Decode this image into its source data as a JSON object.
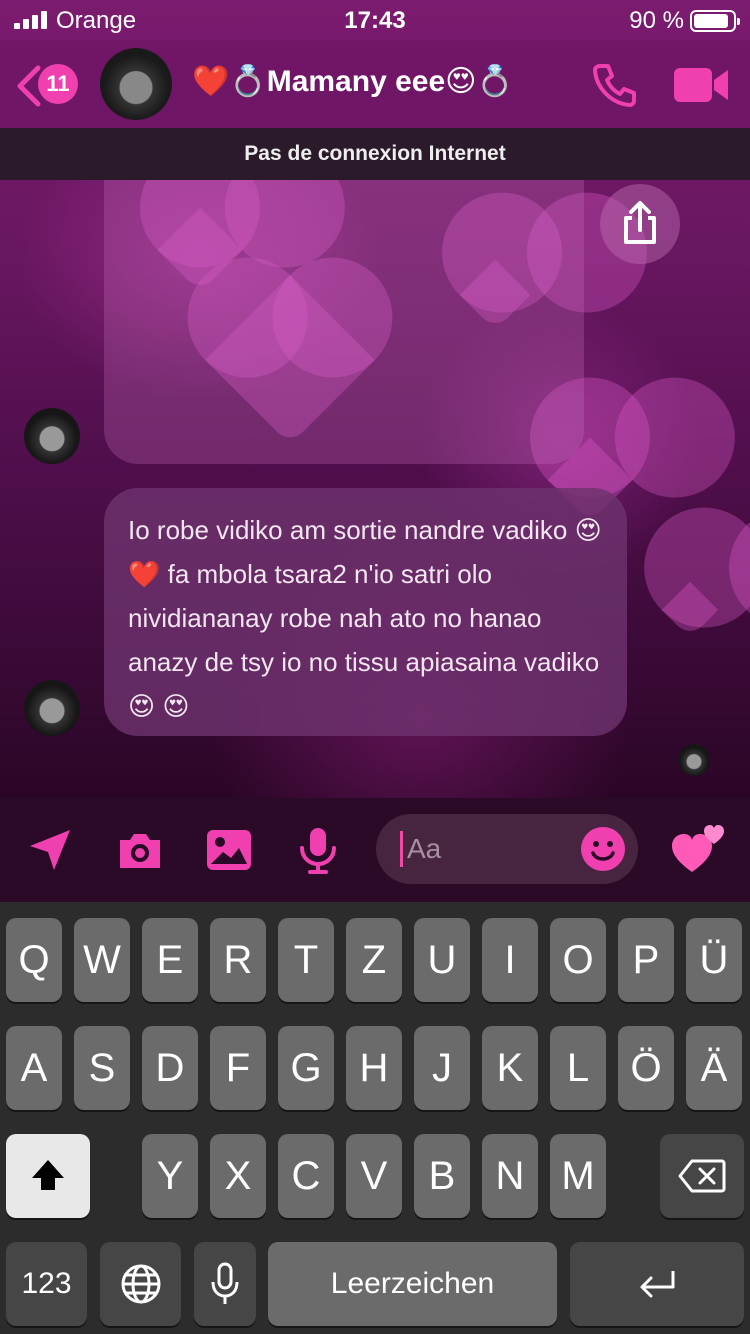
{
  "status_bar": {
    "carrier": "Orange",
    "time": "17:43",
    "battery_percent": "90 %",
    "battery_level": 0.9,
    "signal_bars": 4
  },
  "header": {
    "back_count": "11",
    "title": "❤️💍Mamany eee😍💍",
    "icons": [
      "chevron-left-icon",
      "phone-icon",
      "video-camera-icon"
    ]
  },
  "banner": {
    "text": "Pas de connexion Internet"
  },
  "messages": {
    "incoming_text": "Io robe vidiko am sortie nandre vadiko 😍❤️ fa mbola tsara2 n'io satri olo nividiananay robe nah ato no hanao anazy de tsy io no tissu apiasaina vadiko😍 😍"
  },
  "composer": {
    "placeholder": "Aa",
    "icons": [
      "location-arrow-icon",
      "camera-icon",
      "image-icon",
      "microphone-icon",
      "smiley-icon",
      "hearts-icon"
    ]
  },
  "keyboard": {
    "row1": [
      "Q",
      "W",
      "E",
      "R",
      "T",
      "Z",
      "U",
      "I",
      "O",
      "P",
      "Ü"
    ],
    "row2": [
      "A",
      "S",
      "D",
      "F",
      "G",
      "H",
      "J",
      "K",
      "L",
      "Ö",
      "Ä"
    ],
    "row3": [
      "Y",
      "X",
      "C",
      "V",
      "B",
      "N",
      "M"
    ],
    "numbers_label": "123",
    "space_label": "Leerzeichen"
  },
  "colors": {
    "accent": "#f040b0",
    "keyboard_bg": "#2c2c2c",
    "key": "#6b6b6b",
    "header": "#6e1464"
  }
}
